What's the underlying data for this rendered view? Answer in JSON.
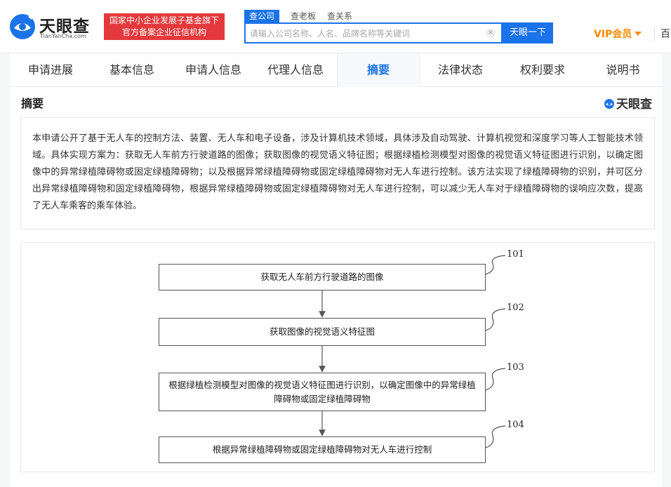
{
  "header": {
    "logo_cn": "天眼查",
    "logo_en": "TianYanCha.com",
    "badge_line1": "国家中小企业发展子基金旗下",
    "badge_line2": "官方备案企业征信机构",
    "search_tabs": [
      "查公司",
      "查老板",
      "查关系"
    ],
    "search_placeholder": "请输入公司名称、人名、品牌名称等关键词",
    "clear_symbol": "×",
    "search_button": "天眼一下",
    "vip_label": "VIP会员",
    "more_nav": "百"
  },
  "tabs": [
    "申请进展",
    "基本信息",
    "申请人信息",
    "代理人信息",
    "摘要",
    "法律状态",
    "权利要求",
    "说明书"
  ],
  "active_tab": "摘要",
  "section": {
    "title": "摘要",
    "watermark": "天眼查"
  },
  "abstract": "本申请公开了基于无人车的控制方法、装置、无人车和电子设备，涉及计算机技术领域，具体涉及自动驾驶、计算机视觉和深度学习等人工智能技术领域。具体实现方案为：获取无人车前方行驶道路的图像；获取图像的视觉语义特征图；根据绿植检测模型对图像的视觉语义特征图进行识别，以确定图像中的异常绿植障碍物或固定绿植障碍物；以及根据异常绿植障碍物或固定绿植障碍物对无人车进行控制。该方法实现了绿植障碍物的识别，并可区分出异常绿植障碍物和固定绿植障碍物，根据异常绿植障碍物或固定绿植障碍物对无人车进行控制，可以减少无人车对于绿植障碍物的误响应次数，提高了无人车乘客的乘车体验。",
  "flowchart": {
    "steps": [
      {
        "number": "101",
        "text": "获取无人车前方行驶道路的图像"
      },
      {
        "number": "102",
        "text": "获取图像的视觉语义特征图"
      },
      {
        "number": "103",
        "text": "根据绿植检测模型对图像的视觉语义特征图进行识别，以确定图像中的异常绿植障碍物或固定绿植障碍物"
      },
      {
        "number": "104",
        "text": "根据异常绿植障碍物或固定绿植障碍物对无人车进行控制"
      }
    ]
  },
  "colors": {
    "brand_blue": "#1a73e8",
    "badge_red": "#e4393c",
    "vip_orange": "#ff8a00"
  }
}
